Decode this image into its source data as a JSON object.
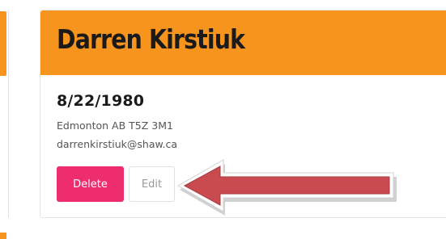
{
  "card": {
    "name": "Darren Kirstiuk",
    "birthdate": "8/22/1980",
    "address": "Edmonton AB T5Z 3M1",
    "email": "darrenkirstiuk@shaw.ca",
    "delete_label": "Delete",
    "edit_label": "Edit"
  },
  "colors": {
    "header": "#f7941d",
    "delete_button": "#ee2d6f",
    "arrow": "#c94a4f"
  },
  "annotation": {
    "icon": "left-arrow-icon"
  }
}
